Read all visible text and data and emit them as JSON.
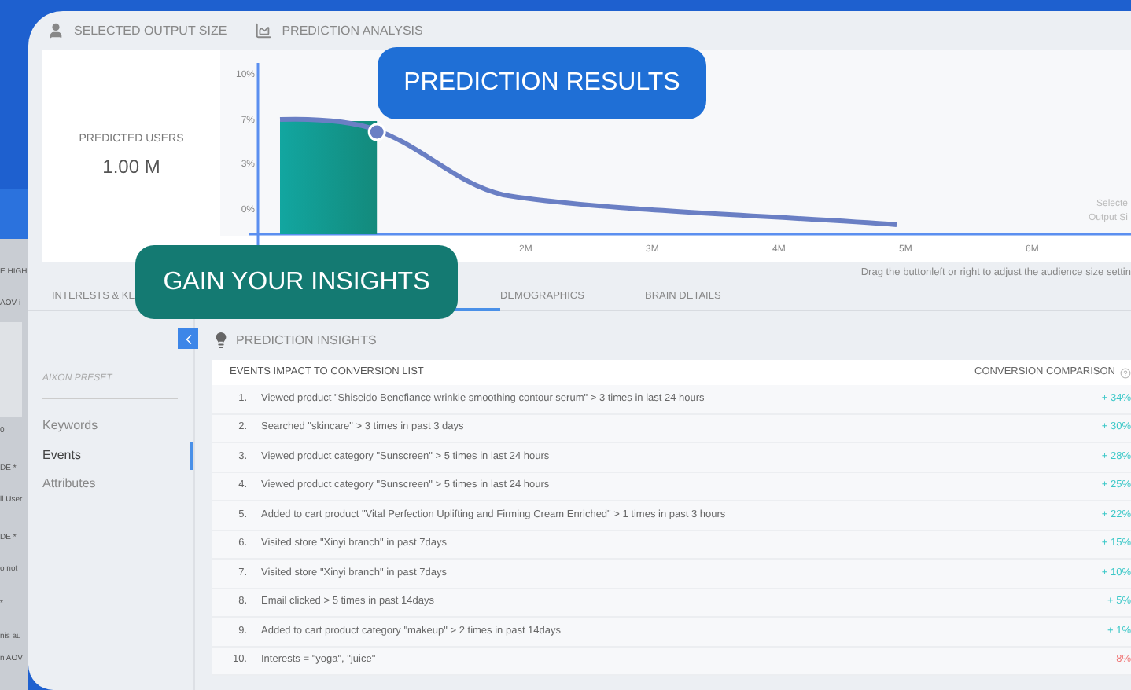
{
  "background_fragments": [
    "E HIGH",
    "AOV i",
    "0",
    "DE *",
    "ll User",
    "DE *",
    "o not",
    "*",
    "nis au",
    "n AOV"
  ],
  "header_tabs": [
    {
      "label": "SELECTED OUTPUT SIZE",
      "kind": "person"
    },
    {
      "label": "PREDICTION ANALYSIS",
      "kind": "chart"
    }
  ],
  "predicted": {
    "label": "PREDICTED USERS",
    "value": "1.00 M"
  },
  "chart": {
    "y_labels": [
      "10%",
      "7%",
      "3%",
      "0%"
    ],
    "x_labels": [
      "2M",
      "3M",
      "4M",
      "5M",
      "6M"
    ],
    "side_note": [
      "Selecte",
      "Output Si"
    ],
    "handle": {
      "level": 0.11
    }
  },
  "hint": "Drag the buttonleft or right to adjust the audience size settin",
  "tabs": [
    {
      "label": "INTERESTS & KE",
      "selected": false
    },
    {
      "label": "DEMOGRAPHICS",
      "selected": false
    },
    {
      "label": "BRAIN DETAILS",
      "selected": false
    }
  ],
  "sidebar": {
    "preset": "AIXON PRESET",
    "items": [
      {
        "label": "Keywords",
        "selected": false
      },
      {
        "label": "Events",
        "selected": true
      },
      {
        "label": "Attributes",
        "selected": false
      }
    ]
  },
  "insights": {
    "title": "PREDICTION INSIGHTS",
    "columns": [
      "EVENTS IMPACT TO CONVERSION LIST",
      "CONVERSION COMPARISON"
    ],
    "rows": [
      {
        "index": "1.",
        "event": "Viewed product \"Shiseido Benefiance wrinkle smoothing contour serum\" > 3 times in last 24 hours",
        "change": "+ 34%",
        "color": "#3cc8c8"
      },
      {
        "index": "2.",
        "event": "Searched \"skincare\" > 3 times in past 3 days",
        "change": "+ 30%",
        "color": "#3cc8c8"
      },
      {
        "index": "3.",
        "event": "Viewed product category \"Sunscreen\" > 5 times in last 24 hours",
        "change": "+ 28%",
        "color": "#3cc8c8"
      },
      {
        "index": "4.",
        "event": "Viewed product category \"Sunscreen\" > 5 times in last 24 hours",
        "change": "+ 25%",
        "color": "#3cc8c8"
      },
      {
        "index": "5.",
        "event": "Added to cart product \"Vital Perfection Uplifting and Firming Cream Enriched\" > 1 times in past 3 hours",
        "change": "+ 22%",
        "color": "#3cc8c8"
      },
      {
        "index": "6.",
        "event": "Visited store \"Xinyi branch\" in past 7days",
        "change": "+ 15%",
        "color": "#3cc8c8"
      },
      {
        "index": "7.",
        "event": "Visited store \"Xinyi branch\" in past 7days",
        "change": "+ 10%",
        "color": "#3cc8c8"
      },
      {
        "index": "8.",
        "event": "Email clicked > 5 times in past 14days",
        "change": "+ 5%",
        "color": "#3cc8c8"
      },
      {
        "index": "9.",
        "event": "Added to cart product category \"makeup\" > 2 times in past 14days",
        "change": "+ 1%",
        "color": "#3cc8c8"
      },
      {
        "index": "10.",
        "event": "Interests = \"yoga\", \"juice\"",
        "change": "- 8%",
        "color": "#f07878"
      }
    ]
  },
  "callouts": [
    {
      "text": "PREDICTION RESULTS",
      "kind": "blue"
    },
    {
      "text": "GAIN YOUR INSIGHTS",
      "kind": "teal"
    }
  ]
}
